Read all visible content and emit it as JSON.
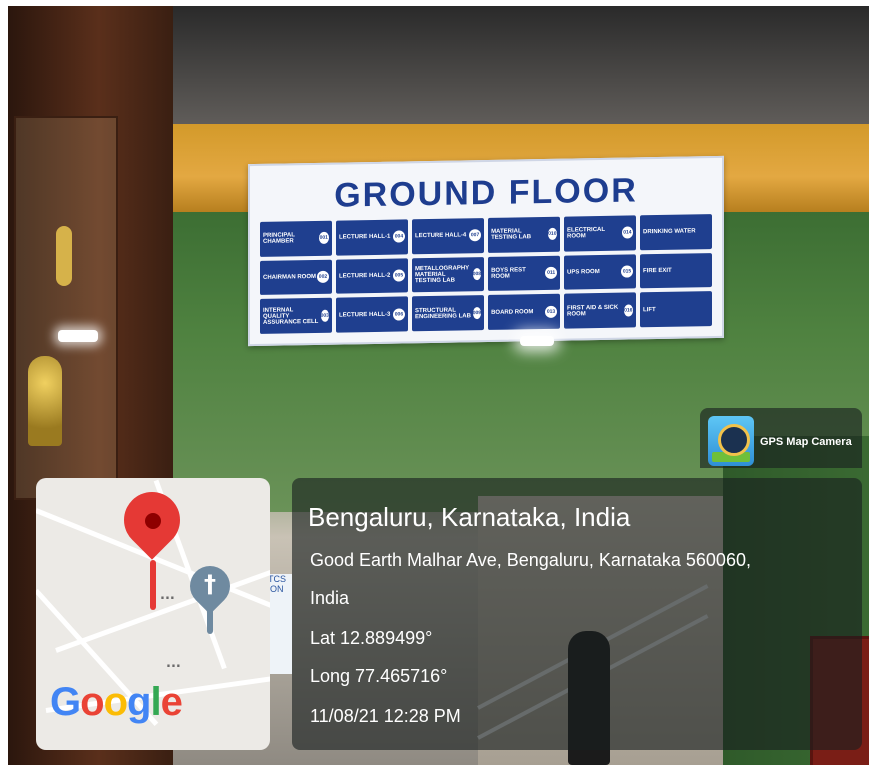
{
  "signboard": {
    "title": "GROUND FLOOR",
    "rows": [
      [
        {
          "label": "PRINCIPAL CHAMBER",
          "num": "001"
        },
        {
          "label": "LECTURE HALL-1",
          "num": "004"
        },
        {
          "label": "LECTURE HALL-4",
          "num": "007"
        },
        {
          "label": "MATERIAL TESTING LAB",
          "num": "010"
        },
        {
          "label": "ELECTRICAL ROOM",
          "num": "014"
        },
        {
          "label": "DRINKING WATER",
          "num": ""
        }
      ],
      [
        {
          "label": "CHAIRMAN ROOM",
          "num": "002"
        },
        {
          "label": "LECTURE HALL-2",
          "num": "005"
        },
        {
          "label": "METALLOGRAPHY MATERIAL TESTING LAB",
          "num": "008"
        },
        {
          "label": "BOYS REST ROOM",
          "num": "011"
        },
        {
          "label": "UPS ROOM",
          "num": "015"
        },
        {
          "label": "FIRE EXIT",
          "num": ""
        }
      ],
      [
        {
          "label": "INTERNAL QUALITY ASSURANCE CELL",
          "num": "003"
        },
        {
          "label": "LECTURE HALL-3",
          "num": "006"
        },
        {
          "label": "STRUCTURAL ENGINEERING LAB",
          "num": "009"
        },
        {
          "label": "BOARD ROOM",
          "num": "013"
        },
        {
          "label": "FIRST AID & SICK ROOM",
          "num": "016"
        },
        {
          "label": "LIFT",
          "num": ""
        }
      ]
    ]
  },
  "overlay": {
    "app_name": "GPS Map Camera",
    "location_title": "Bengaluru, Karnataka, India",
    "address_line1": "Good Earth Malhar Ave, Bengaluru, Karnataka 560060,",
    "address_line2": "India",
    "latitude": "Lat 12.889499°",
    "longitude": "Long 77.465716°",
    "datetime": "11/08/21 12:28 PM"
  },
  "map": {
    "logo_letters": [
      {
        "char": "G",
        "color": "#4285F4"
      },
      {
        "char": "o",
        "color": "#EA4335"
      },
      {
        "char": "o",
        "color": "#FBBC05"
      },
      {
        "char": "g",
        "color": "#4285F4"
      },
      {
        "char": "l",
        "color": "#34A853"
      },
      {
        "char": "e",
        "color": "#EA4335"
      }
    ],
    "cross_glyph": "†",
    "dots": "..."
  },
  "background_text": {
    "tcs": "TCS iON"
  }
}
